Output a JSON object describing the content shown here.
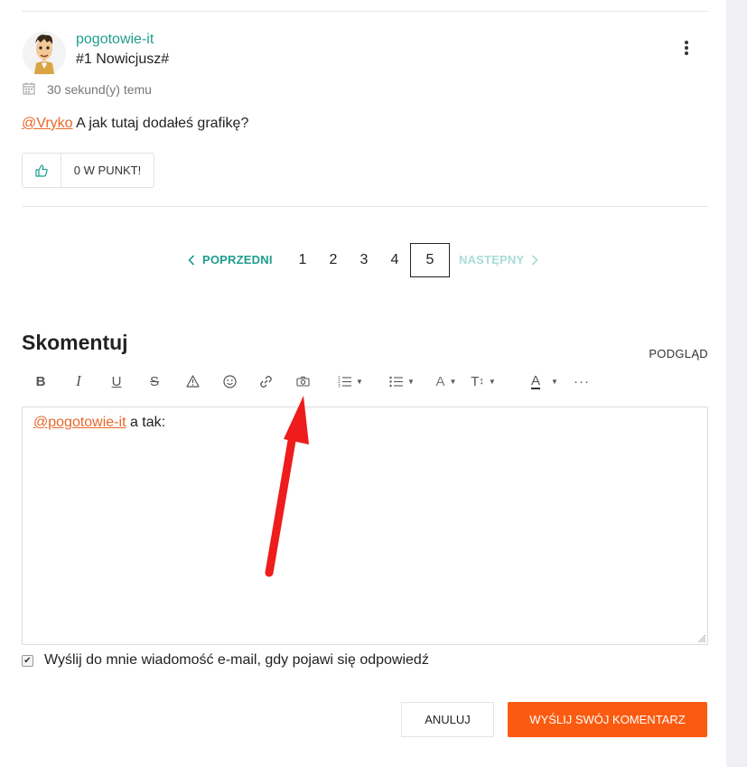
{
  "post": {
    "username": "pogotowie-it",
    "rank": "#1 Nowicjusz#",
    "time": "30 sekund(y) temu",
    "mention": "@Vryko",
    "text": " A jak tutaj dodałeś grafikę?",
    "like_count": "0 W PUNKT!"
  },
  "pagination": {
    "prev": "POPRZEDNI",
    "pages": [
      "1",
      "2",
      "3",
      "4",
      "5"
    ],
    "active": "5",
    "next": "NASTĘPNY"
  },
  "comment_form": {
    "title": "Skomentuj",
    "preview": "PODGLĄD",
    "editor_mention": "@pogotowie-it",
    "editor_text": " a tak:",
    "notify_label": "Wyślij do mnie wiadomość e-mail, gdy pojawi się odpowiedź",
    "notify_checked": true,
    "cancel_label": "ANULUJ",
    "submit_label": "WYŚLIJ SWÓJ KOMENTARZ"
  },
  "toolbar": {
    "bold": "B",
    "italic": "I",
    "underline": "U",
    "strike": "S",
    "font": "A",
    "size": "T",
    "color": "A",
    "more": "···"
  },
  "colors": {
    "accent_teal": "#1f9e8f",
    "mention_orange": "#e8672a",
    "submit_orange": "#fb5b11",
    "annotation_red": "#ee1c1c"
  }
}
